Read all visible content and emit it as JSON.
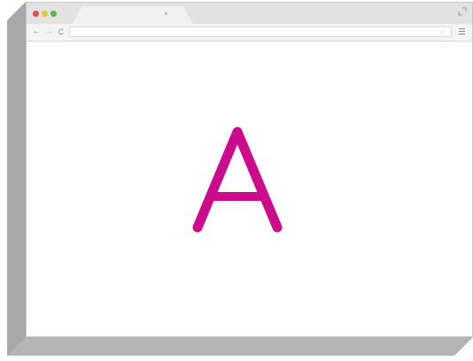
{
  "browser": {
    "tab": {
      "title": "",
      "close_glyph": "×"
    },
    "toolbar": {
      "back_glyph": "←",
      "forward_glyph": "→",
      "reload_glyph": "C",
      "address_value": "",
      "star_glyph": "☆"
    },
    "traffic_lights": {
      "close_color": "#e24b4b",
      "minimize_color": "#e8c23a",
      "maximize_color": "#52b94a"
    }
  },
  "page": {
    "glyph": "A",
    "glyph_color": "#cc0a8c"
  },
  "icons": [
    "fullscreen-icon",
    "menu-icon",
    "star-icon",
    "close-icon"
  ]
}
